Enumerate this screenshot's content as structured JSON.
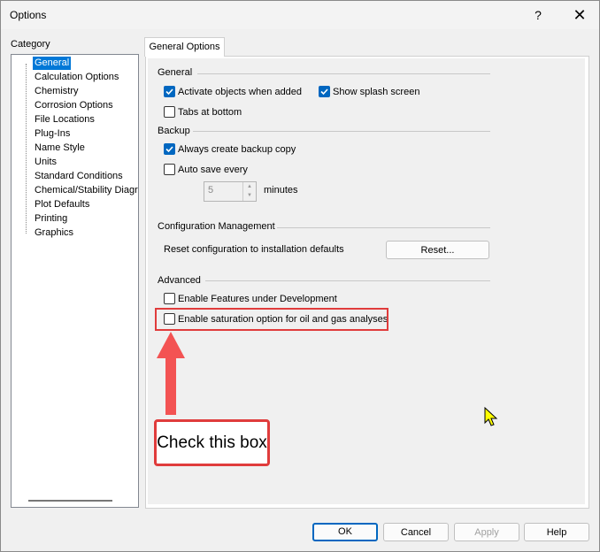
{
  "window": {
    "title": "Options",
    "help_label": "?",
    "close_label": "✕"
  },
  "category": {
    "label": "Category",
    "items": [
      "General",
      "Calculation Options",
      "Chemistry",
      "Corrosion Options",
      "File Locations",
      "Plug-Ins",
      "Name Style",
      "Units",
      "Standard Conditions",
      "Chemical/Stability Diagra",
      "Plot Defaults",
      "Printing",
      "Graphics"
    ],
    "selected": "General"
  },
  "tab": {
    "label": "General Options"
  },
  "general": {
    "heading": "General",
    "activate_objects": {
      "label": "Activate objects when added",
      "checked": true
    },
    "show_splash": {
      "label": "Show splash screen",
      "checked": true
    },
    "tabs_bottom": {
      "label": "Tabs at bottom",
      "checked": false
    }
  },
  "backup": {
    "heading": "Backup",
    "always_backup": {
      "label": "Always create backup copy",
      "checked": true
    },
    "auto_save": {
      "label": "Auto save every",
      "checked": false
    },
    "minutes_value": "5",
    "minutes_label": "minutes"
  },
  "config": {
    "heading": "Configuration Management",
    "reset_text": "Reset configuration to installation defaults",
    "reset_button": "Reset..."
  },
  "advanced": {
    "heading": "Advanced",
    "enable_features": {
      "label": "Enable Features under Development",
      "checked": false
    },
    "saturation": {
      "label": "Enable saturation option for oil and gas analyses",
      "checked": false
    }
  },
  "annotation": {
    "callout_text": "Check this box",
    "color": "#e03c3c"
  },
  "buttons": {
    "ok": "OK",
    "cancel": "Cancel",
    "apply": "Apply",
    "help": "Help"
  },
  "colors": {
    "accent": "#0067c0",
    "selection": "#0078d7",
    "cursor": "#ffff00"
  }
}
